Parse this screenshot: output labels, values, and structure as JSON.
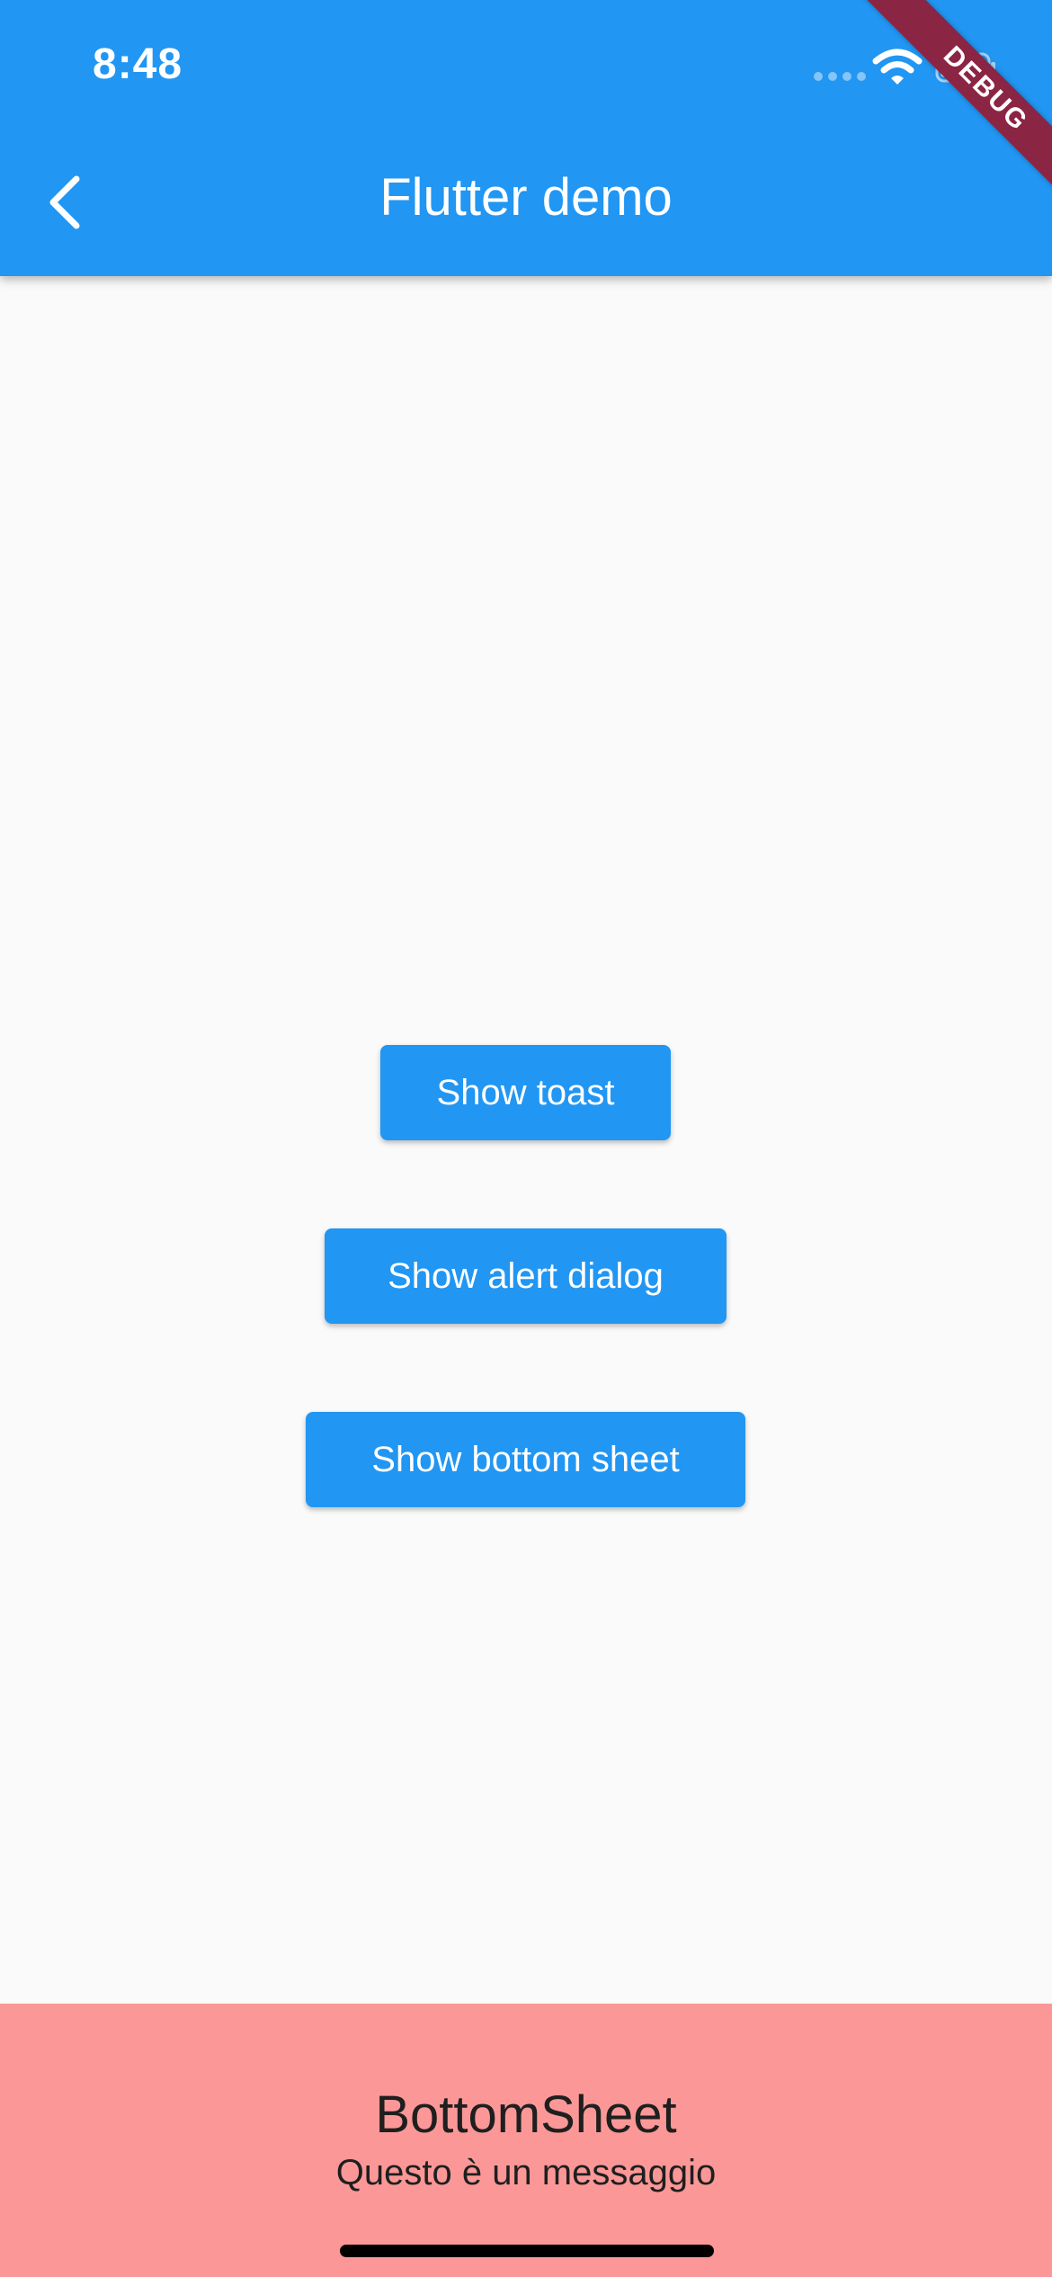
{
  "status_bar": {
    "time": "8:48",
    "icons": [
      "signal-dots-icon",
      "wifi-icon",
      "battery-icon"
    ]
  },
  "debug_banner": {
    "label": "DEBUG"
  },
  "app_bar": {
    "title": "Flutter demo",
    "back_icon": "chevron-left-icon",
    "color": "#2196f3"
  },
  "buttons": {
    "toast": "Show toast",
    "alert": "Show alert dialog",
    "bottom_sheet": "Show bottom sheet"
  },
  "bottom_sheet": {
    "title": "BottomSheet",
    "message": "Questo è un messaggio",
    "color": "#fb9897"
  }
}
